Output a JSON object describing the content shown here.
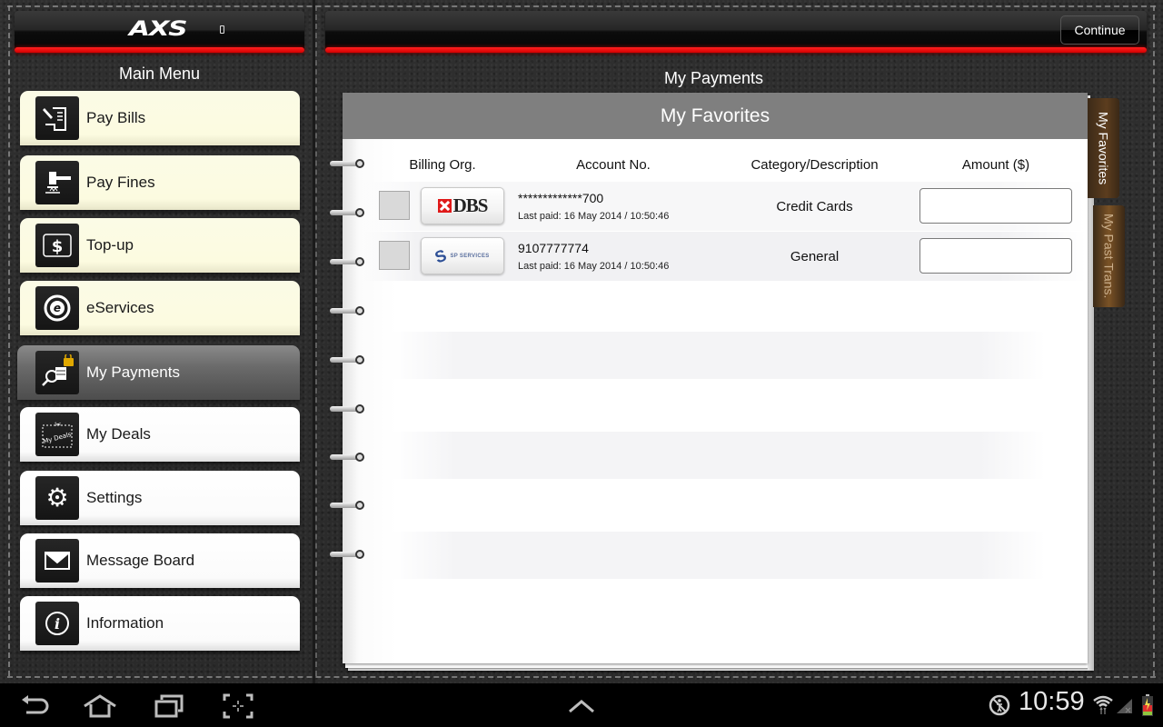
{
  "app": {
    "logo_text": "AXS",
    "continue_label": "Continue",
    "main_menu_title": "Main Menu",
    "page_title": "My Payments"
  },
  "menu": {
    "items": [
      {
        "label": "Pay Bills",
        "icon": "pay-bills-icon"
      },
      {
        "label": "Pay Fines",
        "icon": "gavel-icon"
      },
      {
        "label": "Top-up",
        "icon": "dollar-icon"
      },
      {
        "label": "eServices",
        "icon": "eservices-icon"
      },
      {
        "label": "My Payments",
        "icon": "my-payments-icon",
        "active": true
      },
      {
        "label": "My Deals",
        "icon": "coupon-icon"
      },
      {
        "label": "Settings",
        "icon": "gear-icon"
      },
      {
        "label": "Message Board",
        "icon": "envelope-icon"
      },
      {
        "label": "Information",
        "icon": "info-icon"
      }
    ],
    "my_deals_icon_text": "My Deals"
  },
  "favorites": {
    "title": "My Favorites",
    "columns": [
      "Billing Org.",
      "Account No.",
      "Category/Description",
      "Amount ($)"
    ],
    "rows": [
      {
        "org": "DBS",
        "account": "*************700",
        "last_paid": "Last paid: 16 May 2014 / 10:50:46",
        "category": "Credit Cards",
        "amount": "",
        "checked": false
      },
      {
        "org": "SP SERVICES",
        "account": "9107777774",
        "last_paid": "Last paid: 16 May 2014 / 10:50:46",
        "category": "General",
        "amount": "",
        "checked": false
      }
    ]
  },
  "side_tabs": {
    "favorites": "My Favorites",
    "past_trans": "My Past Trans."
  },
  "status_bar": {
    "time": "10:59"
  },
  "colors": {
    "accent_red": "#e00000",
    "menu_cream": "#fcfbe0",
    "header_gray": "#7f7f7f",
    "tab_brown": "#5c3d1e"
  }
}
